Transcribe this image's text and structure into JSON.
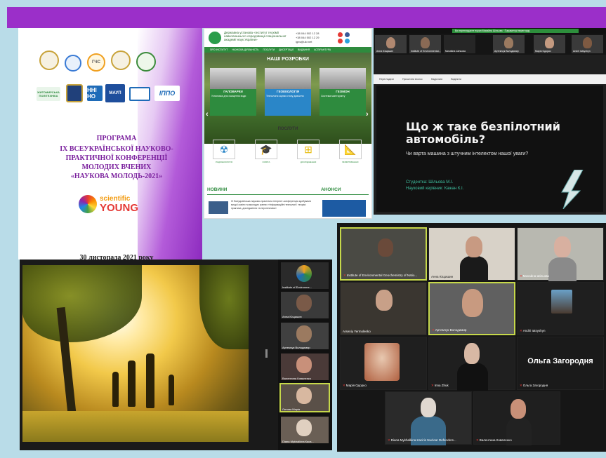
{
  "program": {
    "title_line1": "ПРОГРАМА",
    "title_line2": "IX ВСЕУКРАЇНСЬКОЇ НАУКОВО-ПРАКТИЧНОЇ КОНФЕРЕНЦІЇ МОЛОДИХ ВЧЕНИХ",
    "title_line3": "«НАУКОВА МОЛОДЬ-2021»",
    "logo_top": "scientific",
    "logo_bottom": "YOUNG",
    "date": "30 листопада 2021 року",
    "logos": [
      "ГЧС",
      "ЖИТОМИРСЬКА ПОЛІТЕХНІКА",
      "ННІ НО",
      "МАУП",
      "ІППО"
    ]
  },
  "website": {
    "hero_title": "НАШІ РОЗРОБКИ",
    "cards": [
      "ГАЛОВАРКИ",
      "ГЕОЕКОЛОГІЯ",
      "ГЕОМОН"
    ],
    "services_title": "ПОСЛУГИ",
    "news_title": "НОВИНИ",
    "announcements_title": "АНОНСИ",
    "news_text": "IX Всеукраїнська науково-практична інтернет-конференція здобувачів вищої освіти та молодих учених «Інформаційні технології: теорія і практика, дослідження та перспективи»"
  },
  "zoom_presentation": {
    "slide_title": "Що ж таке безпілотний автомобіль?",
    "slide_subtitle": "Чи варта машина з штучним інтелектом нашої уваги?",
    "student": "Студентка: Шільова М.І.",
    "supervisor": "Науковий керівник: Кажан К.І.",
    "participants": [
      "Анна Ющишин",
      "Institute of Environmental...",
      "Михайна Шільова",
      "Артемчук Володимир",
      "Марія Одорко",
      "Andrii Iatsyshyn"
    ]
  },
  "zoom_side": {
    "participants": [
      "Institute of Environme...",
      "Анна Ющишин",
      "Артемчук Володимир",
      "Валентина Коваленко",
      "Литова Марія",
      "Diana Mykhalkina Каса..."
    ]
  },
  "zoom_gallery": {
    "participants": [
      "Institute of Environmental Geochemistry of Natio...",
      "Анна Ющишин",
      "Михайна Шільова",
      "Arseniy Yermolenko",
      "Артемчук Володимир",
      "Andrii Iatsyshyn",
      "Марія Одорко",
      "Inna Zhuk",
      "Ольга Загородня",
      "Diana Mykhalkina Kaciris Nuclear Defenders...",
      "Валентина Коваленко"
    ],
    "big_name": "Ольга Загородня"
  },
  "colors": {
    "banner": "#9b2fc9",
    "accent_green": "#2e8b3e",
    "zoom_active_border": "#c6d84a"
  }
}
